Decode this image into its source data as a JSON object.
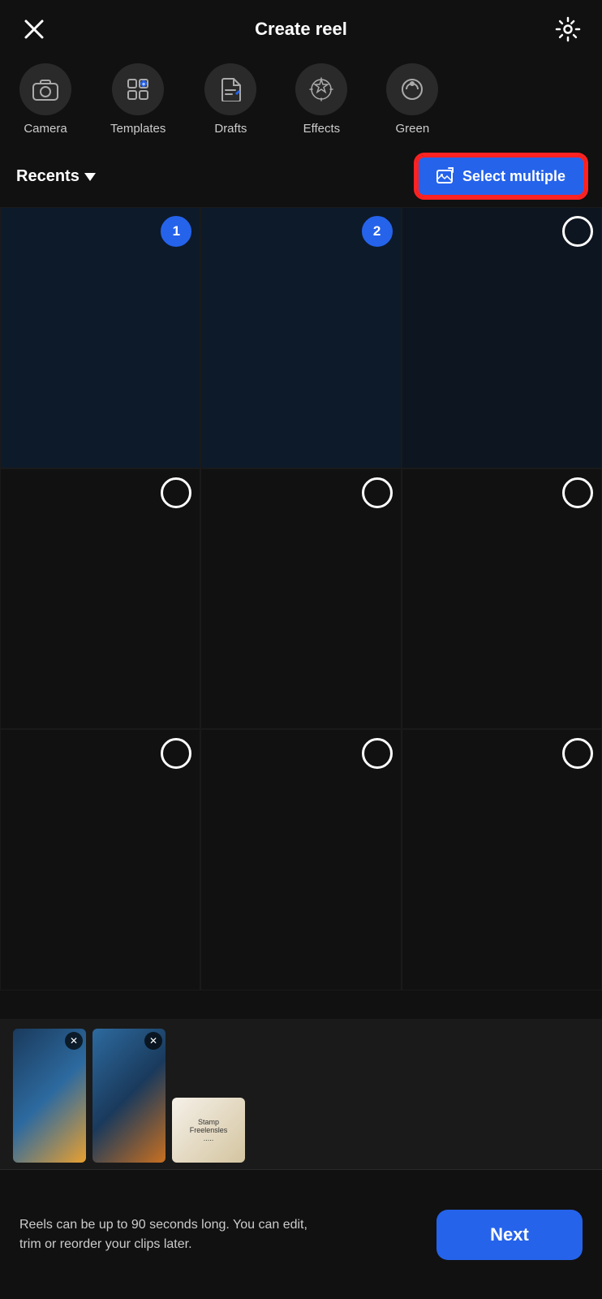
{
  "header": {
    "title": "Create reel",
    "close_label": "×",
    "settings_label": "⚙"
  },
  "tabs": [
    {
      "id": "camera",
      "label": "Camera",
      "icon": "camera"
    },
    {
      "id": "templates",
      "label": "Templates",
      "icon": "templates"
    },
    {
      "id": "drafts",
      "label": "Drafts",
      "icon": "drafts"
    },
    {
      "id": "effects",
      "label": "Effects",
      "icon": "effects"
    },
    {
      "id": "green",
      "label": "Green",
      "icon": "green"
    }
  ],
  "recents": {
    "label": "Recents",
    "dropdown_label": "▼"
  },
  "select_multiple": {
    "label": "Select multiple"
  },
  "grid": {
    "cells": [
      {
        "id": 1,
        "selected": true,
        "number": "1"
      },
      {
        "id": 2,
        "selected": true,
        "number": "2"
      },
      {
        "id": 3,
        "selected": false,
        "number": ""
      },
      {
        "id": 4,
        "selected": false,
        "number": ""
      },
      {
        "id": 5,
        "selected": false,
        "number": ""
      },
      {
        "id": 6,
        "selected": false,
        "number": ""
      },
      {
        "id": 7,
        "selected": false,
        "number": ""
      },
      {
        "id": 8,
        "selected": false,
        "number": ""
      },
      {
        "id": 9,
        "selected": false,
        "number": ""
      }
    ]
  },
  "bottom_bar": {
    "info_text": "Reels can be up to 90 seconds long. You can edit, trim or reorder your clips later.",
    "next_label": "Next"
  }
}
